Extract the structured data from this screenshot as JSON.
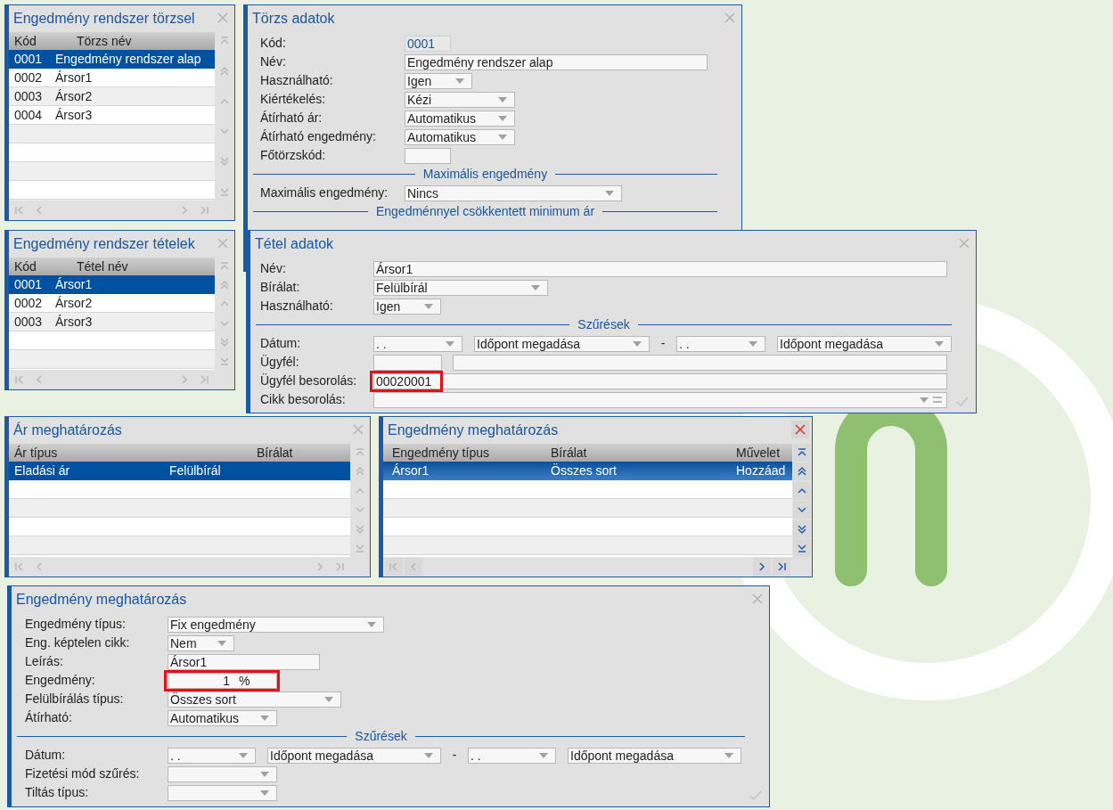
{
  "windows": [
    {
      "kind": "grid",
      "title": "Engedmény rendszer törzsel",
      "active": false,
      "columns": [
        "Kód",
        "Törzs név"
      ],
      "rows": [
        {
          "cells": [
            "0001",
            "Engedmény rendszer alap"
          ],
          "selected": true
        },
        {
          "cells": [
            "0002",
            "Ársor1"
          ],
          "selected": false
        },
        {
          "cells": [
            "0003",
            "Ársor2"
          ],
          "selected": false
        },
        {
          "cells": [
            "0004",
            "Ársor3"
          ],
          "selected": false
        }
      ]
    },
    {
      "kind": "form",
      "title": "Törzs adatok",
      "active": false,
      "items": [
        {
          "kind": "text",
          "label": "Kód:",
          "value": "0001",
          "readonly": true,
          "highlighted": false
        },
        {
          "kind": "text",
          "label": "Név:",
          "value": "Engedmény rendszer alap",
          "readonly": false,
          "highlighted": false
        },
        {
          "kind": "select",
          "label": "Használható:",
          "value": "Igen"
        },
        {
          "kind": "select",
          "label": "Kiértékelés:",
          "value": "Kézi"
        },
        {
          "kind": "select",
          "label": "Átírható ár:",
          "value": "Automatikus"
        },
        {
          "kind": "select",
          "label": "Átírható engedmény:",
          "value": "Automatikus"
        },
        {
          "kind": "text",
          "label": "Főtörzskód:",
          "readonly": false,
          "highlighted": false
        },
        {
          "kind": "section",
          "label": "Maximális engedmény"
        },
        {
          "kind": "select",
          "label": "Maximális engedmény:",
          "value": "Nincs"
        },
        {
          "kind": "section",
          "label": "Engedménnyel csökkentett minimum ár"
        }
      ]
    },
    {
      "kind": "grid",
      "title": "Engedmény rendszer tételek",
      "active": false,
      "columns": [
        "Kód",
        "Tétel név"
      ],
      "rows": [
        {
          "cells": [
            "0001",
            "Ársor1"
          ],
          "selected": true
        },
        {
          "cells": [
            "0002",
            "Ársor2"
          ],
          "selected": false
        },
        {
          "cells": [
            "0003",
            "Ársor3"
          ],
          "selected": false
        }
      ]
    },
    {
      "kind": "form",
      "title": "Tétel adatok",
      "active": false,
      "items": [
        {
          "kind": "text",
          "label": "Név:",
          "value": "Ársor1",
          "readonly": false,
          "highlighted": false
        },
        {
          "kind": "select",
          "label": "Bírálat:",
          "value": "Felülbírál"
        },
        {
          "kind": "select",
          "label": "Használható:",
          "value": "Igen"
        },
        {
          "kind": "section",
          "label": "Szűrések"
        },
        {
          "kind": "date_range",
          "label": "Dátum:",
          "parts": [
            ". .",
            "Időpont megadása",
            ". .",
            "Időpont megadása"
          ],
          "dash": "-"
        },
        {
          "kind": "pair",
          "label": "Ügyfél:"
        },
        {
          "kind": "text",
          "label": "Ügyfél besorolás:",
          "value": "00020001",
          "readonly": false,
          "highlighted": true
        },
        {
          "kind": "lookup",
          "label": "Cikk besorolás:"
        }
      ]
    },
    {
      "kind": "grid",
      "title": "Ár meghatározás",
      "active": false,
      "columns": [
        "Ár típus",
        "Bírálat"
      ],
      "rows": [
        {
          "cells": [
            "Eladási ár",
            "Felülbírál"
          ],
          "selected": true
        }
      ]
    },
    {
      "kind": "grid",
      "title": "Engedmény meghatározás",
      "active": true,
      "columns": [
        "Engedmény típus",
        "Bírálat",
        "Művelet"
      ],
      "rows": [
        {
          "cells": [
            "Ársor1",
            "Összes sort",
            "Hozzáad"
          ],
          "selected": true
        }
      ]
    },
    {
      "kind": "form",
      "title": "Engedmény meghatározás",
      "active": false,
      "items": [
        {
          "kind": "select",
          "label": "Engedmény típus:",
          "value": "Fix engedmény"
        },
        {
          "kind": "select",
          "label": "Eng. képtelen cikk:",
          "value": "Nem"
        },
        {
          "kind": "text",
          "label": "Leírás:",
          "value": "Ársor1",
          "readonly": false,
          "highlighted": false
        },
        {
          "kind": "percent",
          "label": "Engedmény:",
          "value": "1",
          "unit": "%",
          "highlighted": true
        },
        {
          "kind": "select",
          "label": "Felülbírálás típus:",
          "value": "Összes sort"
        },
        {
          "kind": "select",
          "label": "Átírható:",
          "value": "Automatikus"
        },
        {
          "kind": "section",
          "label": "Szűrések"
        },
        {
          "kind": "date_range",
          "label": "Dátum:",
          "parts": [
            ". .",
            "Időpont megadása",
            ". .",
            "Időpont megadása"
          ],
          "dash": "-"
        },
        {
          "kind": "select",
          "label": "Fizetési mód szűrés:"
        },
        {
          "kind": "select",
          "label": "Tiltás típus:"
        }
      ]
    }
  ]
}
